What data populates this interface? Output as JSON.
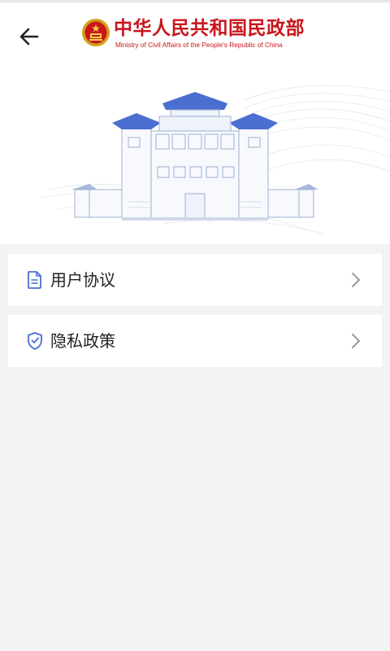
{
  "header": {
    "back_icon": "arrow-left-icon",
    "logo": {
      "emblem_icon": "national-emblem-icon",
      "title_cn": "中华人民共和国民政部",
      "title_en": "Ministry of Civil Affairs of the People's Republic of China"
    },
    "illustration": "ministry-building-illustration"
  },
  "menu": {
    "items": [
      {
        "label": "用户协议",
        "icon": "document-icon",
        "chevron": "chevron-right-icon"
      },
      {
        "label": "隐私政策",
        "icon": "shield-check-icon",
        "chevron": "chevron-right-icon"
      }
    ]
  },
  "colors": {
    "brand_red": "#c8161d",
    "accent_blue": "#4a6fd1",
    "background": "#f3f3f3"
  }
}
